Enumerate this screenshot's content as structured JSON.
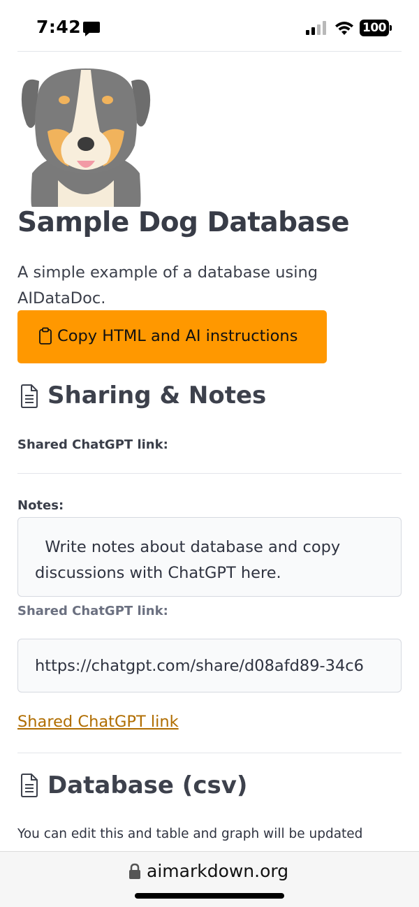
{
  "status_bar": {
    "time": "7:42",
    "battery": "100",
    "icons": [
      "message-icon",
      "cellular-signal-icon",
      "wifi-icon",
      "battery-icon"
    ]
  },
  "header": {
    "title": "Sample Dog Database",
    "intro": "A simple example of a database using AIDataDoc.",
    "copy_button_label": "Copy HTML and AI instructions",
    "logo_icon": "dog-logo-icon"
  },
  "sharing": {
    "title": "Sharing & Notes",
    "shared_link_label": "Shared ChatGPT link:",
    "notes_label": "Notes:",
    "notes_value": "  Write notes about database and copy discussions with ChatGPT here.",
    "link_field_label": "Shared ChatGPT link:",
    "link_field_value": "https://chatgpt.com/share/d08afd89-34c6",
    "link_text": "Shared ChatGPT link"
  },
  "database": {
    "title": "Database (csv)",
    "description": "You can edit this and table and graph will be updated"
  },
  "browser": {
    "url": "aimarkdown.org"
  },
  "colors": {
    "accent": "#ff9800",
    "link": "#b06d00",
    "heading": "#383c47"
  }
}
